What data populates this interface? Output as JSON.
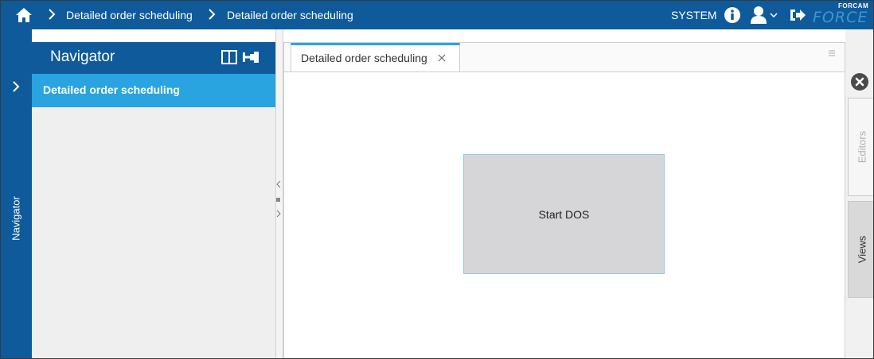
{
  "topbar": {
    "breadcrumbs": [
      {
        "label": "Detailed order scheduling"
      },
      {
        "label": "Detailed order scheduling"
      }
    ],
    "system_label": "SYSTEM",
    "logo": {
      "small": "FORCAM",
      "big": "FORCE"
    },
    "icons": [
      "home-icon",
      "chevron-right-icon",
      "info-icon",
      "user-icon",
      "chevron-down-icon",
      "logout-icon"
    ]
  },
  "left_strip": {
    "label": "Navigator"
  },
  "navigator": {
    "title": "Navigator",
    "items": [
      {
        "label": "Detailed order scheduling",
        "active": true
      }
    ]
  },
  "editor": {
    "tabs": [
      {
        "label": "Detailed order scheduling",
        "active": true
      }
    ],
    "start_button_label": "Start DOS"
  },
  "right_strip": {
    "tabs": [
      {
        "label": "Editors",
        "state": "inactive"
      },
      {
        "label": "Views",
        "state": "active"
      }
    ]
  },
  "colors": {
    "header_blue": "#0f5a9b",
    "active_item_blue": "#29a4e0",
    "nav_background": "#efefef",
    "button_gray": "#d6d6d9",
    "logo_blue": "#3b97d6"
  }
}
